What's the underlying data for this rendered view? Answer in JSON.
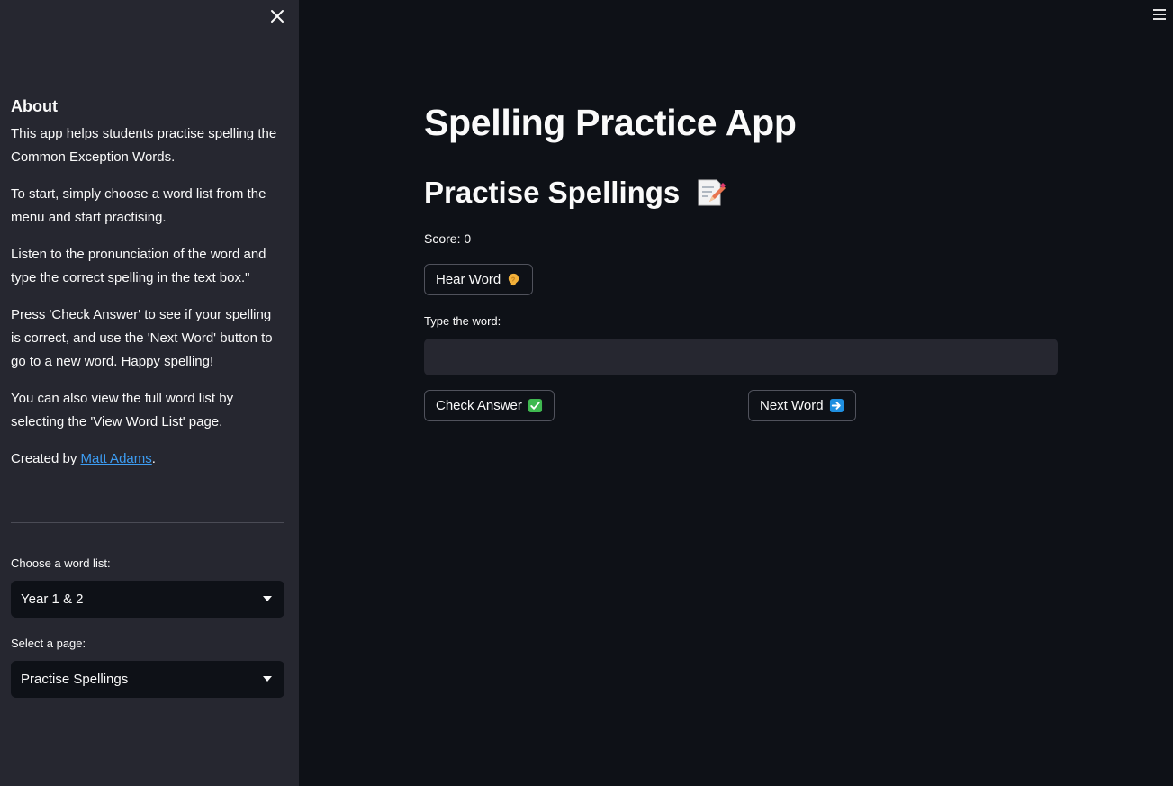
{
  "sidebar": {
    "about_title": "About",
    "paragraphs": [
      "This app helps students practise spelling the Common Exception Words.",
      "To start, simply choose a word list from the menu and start practising.",
      "Listen to the pronunciation of the word and type the correct spelling in the text box.\"",
      "Press 'Check Answer' to see if your spelling is correct, and use the 'Next Word' button to go to a new word. Happy spelling!",
      "You can also view the full word list by selecting the 'View Word List' page."
    ],
    "created_prefix": "Created by ",
    "author_link": "Matt Adams",
    "created_suffix": ".",
    "word_list_label": "Choose a word list:",
    "word_list_value": "Year 1 & 2",
    "page_label": "Select a page:",
    "page_value": "Practise Spellings",
    "close_icon": "close-icon"
  },
  "main": {
    "title": "Spelling Practice App",
    "subtitle": "Practise Spellings",
    "subtitle_icon": "memo-pencil-icon",
    "score_text": "Score: 0",
    "hear_button": "Hear Word",
    "hear_icon": "ear-icon",
    "input_label": "Type the word:",
    "input_value": "",
    "check_button": "Check Answer",
    "check_icon": "check-mark-icon",
    "next_button": "Next Word",
    "next_icon": "right-arrow-icon"
  },
  "colors": {
    "background": "#0e1117",
    "sidebar": "#262730",
    "text": "#fafafa",
    "link": "#3d9df3",
    "check_green": "#3fb950",
    "arrow_blue": "#1f8fe0"
  }
}
